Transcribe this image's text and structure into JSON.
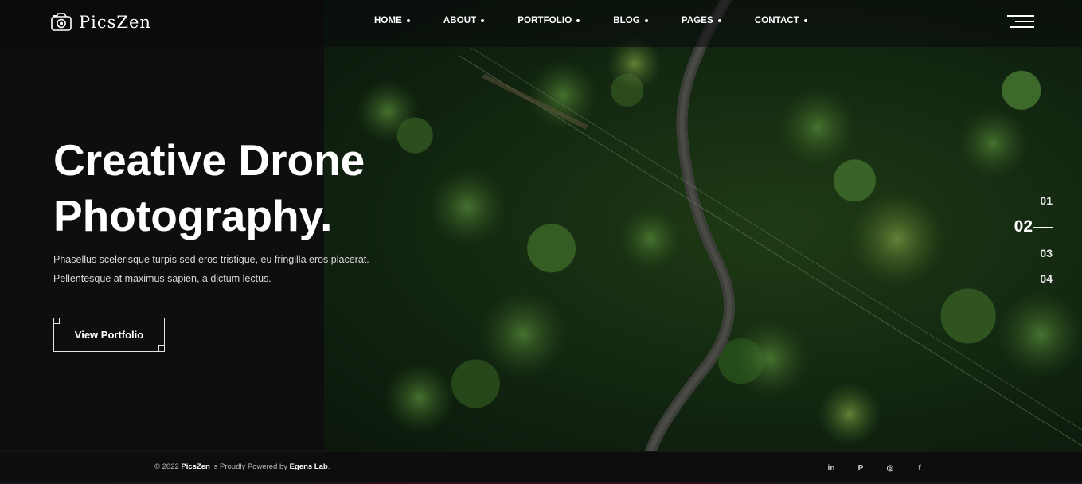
{
  "brand": {
    "name": "PicsZen",
    "logo_icon": "camera-icon"
  },
  "nav": {
    "items": [
      {
        "label": "HOME"
      },
      {
        "label": "ABOUT"
      },
      {
        "label": "PORTFOLIO"
      },
      {
        "label": "BLOG"
      },
      {
        "label": "PAGES"
      },
      {
        "label": "CONTACT"
      }
    ],
    "menu_icon": "hamburger-menu-icon"
  },
  "hero": {
    "title_line1": "Creative Drone",
    "title_line2": "Photography.",
    "desc_line1": "Phasellus scelerisque turpis sed eros tristique, eu fringilla eros placerat.",
    "desc_line2": "Pellentesque at maximus sapien, a dictum lectus.",
    "cta_label": "View Portfolio"
  },
  "pager": {
    "items": [
      "01",
      "02",
      "03",
      "04"
    ],
    "active": "02"
  },
  "footer": {
    "copyright_prefix": "© 2022 ",
    "brand": "PicsZen",
    "copyright_middle": " is Proudly Powered by ",
    "powered_by": "Egens Lab",
    "copyright_suffix": ".",
    "socials": [
      {
        "name": "linkedin-icon",
        "glyph": "in"
      },
      {
        "name": "pinterest-icon",
        "glyph": "P"
      },
      {
        "name": "instagram-icon",
        "glyph": "◎"
      },
      {
        "name": "facebook-icon",
        "glyph": "f"
      }
    ]
  },
  "colors": {
    "background": "#0e0e10",
    "text": "#ffffff",
    "forest": "#1f3b14"
  }
}
